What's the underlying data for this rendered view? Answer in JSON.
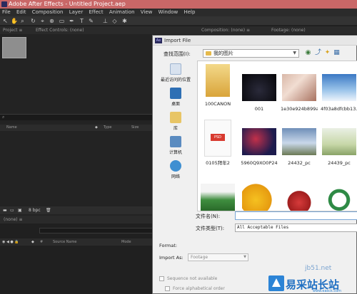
{
  "app": {
    "title": "Adobe After Effects - Untitled Project.aep",
    "menu": [
      "File",
      "Edit",
      "Composition",
      "Layer",
      "Effect",
      "Animation",
      "View",
      "Window",
      "Help"
    ]
  },
  "panels": {
    "project_tab": "Project ≡",
    "effect_controls_tab": "Effect Controls: (none)",
    "composition_tab": "Composition: (none) ≡",
    "footage_tab": "Footage: (none)",
    "project_columns": [
      "Name",
      "Type",
      "Size"
    ],
    "bpc": "8 bpc",
    "timeline_tab": "(none) ≡",
    "timeline_columns": [
      "Source Name",
      "Mode"
    ]
  },
  "dialog": {
    "title": "Import File",
    "look_in_label": "查找范围(I):",
    "look_in_value": "我的图片",
    "places": [
      {
        "label": "最近访问的位置",
        "icon": "recent-places-icon"
      },
      {
        "label": "桌面",
        "icon": "desktop-icon"
      },
      {
        "label": "库",
        "icon": "libraries-icon"
      },
      {
        "label": "计算机",
        "icon": "computer-icon"
      },
      {
        "label": "网络",
        "icon": "network-icon"
      }
    ],
    "files": [
      {
        "name": "100CANON",
        "kind": "folder"
      },
      {
        "name": "001",
        "kind": "image"
      },
      {
        "name": "1e30e924b899a...",
        "kind": "image"
      },
      {
        "name": "4f03a8dfcbb13...",
        "kind": "image"
      },
      {
        "name": "0105拜年2",
        "kind": "psd"
      },
      {
        "name": "5960Q9XO0P24",
        "kind": "image"
      },
      {
        "name": "24432_pc",
        "kind": "image"
      },
      {
        "name": "24439_pc",
        "kind": "image"
      },
      {
        "name": "",
        "kind": "image"
      },
      {
        "name": "",
        "kind": "image"
      },
      {
        "name": "",
        "kind": "image"
      },
      {
        "name": "",
        "kind": "image"
      }
    ],
    "file_name_label": "文件名(N):",
    "file_name_value": "",
    "file_type_label": "文件类型(T):",
    "file_type_value": "All Acceptable Files",
    "format_label": "Format:",
    "import_as_label": "Import As:",
    "import_as_value": "Footage",
    "sequence_label": "Sequence not available",
    "force_alpha_label": "Force alphabetical order"
  },
  "watermark": {
    "site": "jb51.net",
    "brand": "易采站长站",
    "sub": "www.easck.com"
  }
}
